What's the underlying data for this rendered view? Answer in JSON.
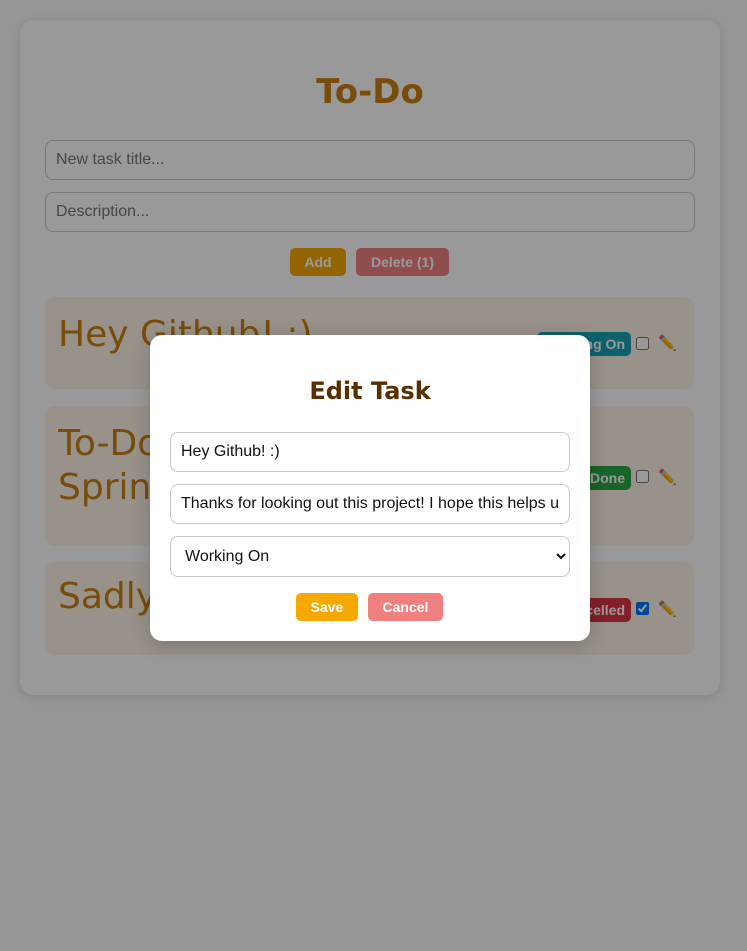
{
  "app": {
    "title": "To-Do",
    "title_placeholder": "New task title...",
    "description_placeholder": "Description...",
    "add_label": "Add",
    "delete_label": "Delete (1)"
  },
  "tasks": [
    {
      "title": "Hey Github! :)",
      "status": "Working On",
      "status_color": "#17a2b8",
      "checked": false
    },
    {
      "title": "To-Do Spring",
      "status": "Done",
      "status_color": "#28a745",
      "checked": false
    },
    {
      "title": "Sadly...",
      "status": "Cancelled",
      "status_color": "#dc3545",
      "checked": true
    }
  ],
  "modal": {
    "title": "Edit Task",
    "task_title_value": "Hey Github! :)",
    "task_description_value": "Thanks for looking out this project! I hope this helps u",
    "status_value": "Working On",
    "save_label": "Save",
    "cancel_label": "Cancel"
  },
  "icons": {
    "edit": "pencil-icon"
  },
  "colors": {
    "accent": "#c97f12",
    "add_button": "#f5a800",
    "delete_button": "#f08080",
    "modal_title": "#5a2e00"
  }
}
